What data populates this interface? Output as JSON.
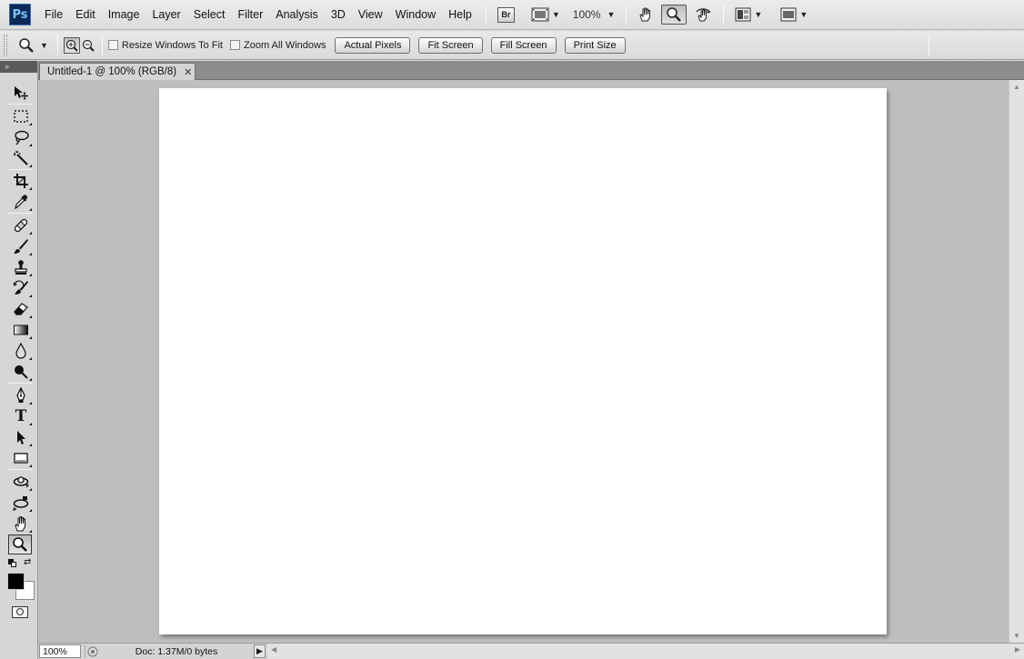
{
  "app": {
    "logo_text": "Ps",
    "brand_color": "#0a2a57"
  },
  "menubar": {
    "items": [
      "File",
      "Edit",
      "Image",
      "Layer",
      "Select",
      "Filter",
      "Analysis",
      "3D",
      "View",
      "Window",
      "Help"
    ],
    "bridge_label": "Br",
    "zoom_value": "100%"
  },
  "options": {
    "resize_windows_label": "Resize Windows To Fit",
    "zoom_all_label": "Zoom All Windows",
    "actual_pixels_label": "Actual Pixels",
    "fit_screen_label": "Fit Screen",
    "fill_screen_label": "Fill Screen",
    "print_size_label": "Print Size",
    "resize_windows_checked": false,
    "zoom_all_checked": false
  },
  "toolbox": {
    "header": "»",
    "tools": [
      "move-icon",
      "marquee-icon",
      "lasso-icon",
      "magic-wand-icon",
      "crop-icon",
      "eyedropper-icon",
      "healing-brush-icon",
      "brush-icon",
      "clone-stamp-icon",
      "history-brush-icon",
      "eraser-icon",
      "gradient-icon",
      "blur-icon",
      "dodge-icon",
      "pen-icon",
      "type-icon",
      "path-selection-icon",
      "rectangle-icon",
      "3d-rotate-icon",
      "3d-orbit-icon",
      "hand-icon",
      "zoom-icon"
    ],
    "selected_tool": "zoom-icon",
    "foreground_color": "#000000",
    "background_color": "#ffffff",
    "type_glyph": "T"
  },
  "document": {
    "tab_title": "Untitled-1 @ 100% (RGB/8)",
    "canvas_color": "#ffffff"
  },
  "status": {
    "zoom": "100%",
    "doc_info": "Doc: 1.37M/0 bytes"
  }
}
